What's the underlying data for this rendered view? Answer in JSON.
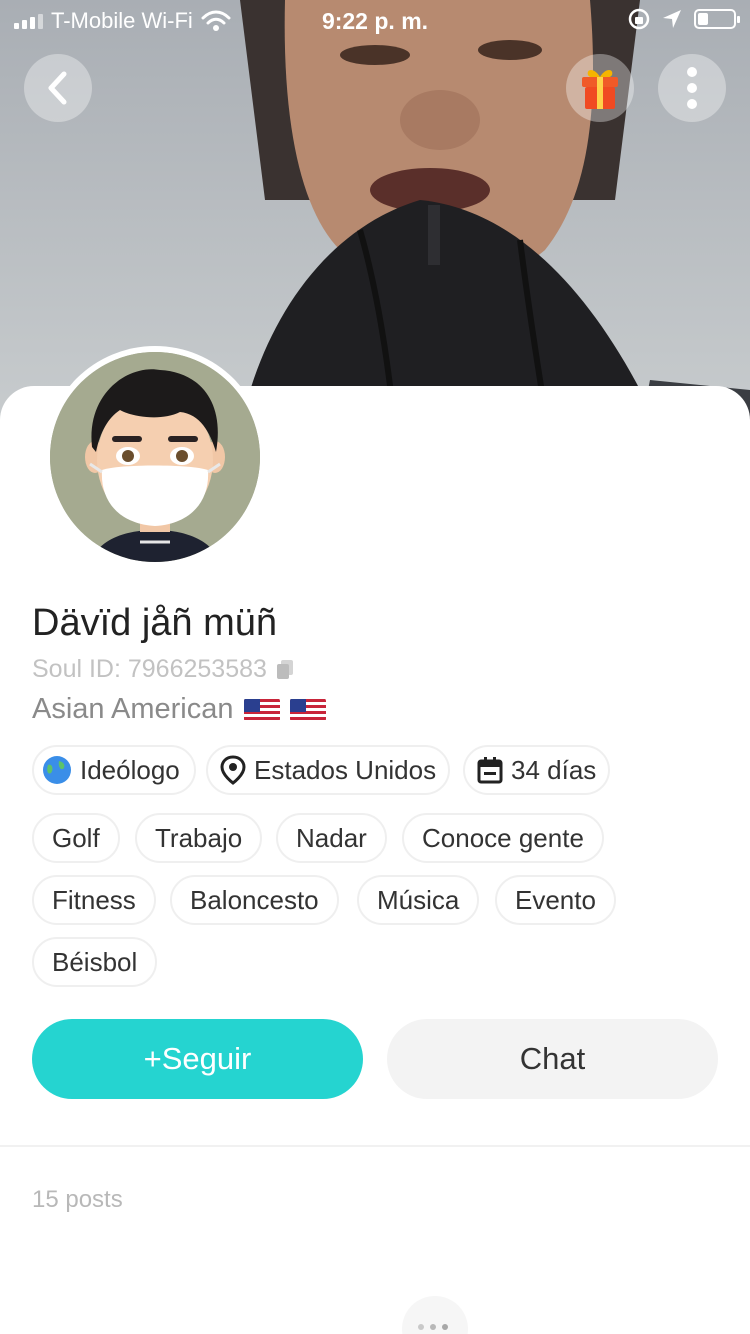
{
  "status_bar": {
    "carrier": "T-Mobile Wi-Fi",
    "time": "9:22 p. m."
  },
  "header_icons": {
    "back": "back-chevron-icon",
    "gift": "gift-icon",
    "more": "more-vertical-icon"
  },
  "profile": {
    "name": "Dävïd jåñ müñ",
    "soul_id": "Soul ID: 7966253583",
    "bio": "Asian American",
    "bio_flags": [
      "🇺🇸",
      "🇺🇸"
    ]
  },
  "info_chips": [
    {
      "label": "Ideólogo",
      "icon": "globe-icon"
    },
    {
      "label": "Estados Unidos",
      "icon": "location-pin-icon"
    },
    {
      "label": "34 días",
      "icon": "calendar-icon"
    }
  ],
  "tags": [
    "Golf",
    "Trabajo",
    "Nadar",
    "Conoce gente",
    "Fitness",
    "Baloncesto",
    "Música",
    "Evento",
    "Béisbol"
  ],
  "actions": {
    "follow": "+Seguir",
    "chat": "Chat"
  },
  "posts": {
    "count_label": "15 posts"
  },
  "colors": {
    "accent": "#25d4d0",
    "chat_bg": "#f3f3f3"
  }
}
